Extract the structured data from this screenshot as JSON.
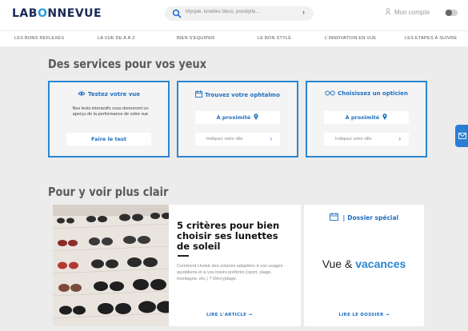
{
  "header": {
    "logo": {
      "part1": "LAB",
      "part2": "O",
      "part3": "NNEVUE"
    },
    "search_placeholder": "Myopie, lunettes bleus, presbytie...",
    "search_go": "›",
    "account_label": "Mon compte"
  },
  "nav": [
    "LES BONS REFLEXES",
    "LA VUE DE A À Z",
    "BIEN S'EQUIPER",
    "LE BON STYLE",
    "L'INNOVATION EN VUE",
    "LES ETAPES À SUIVRE"
  ],
  "services": {
    "heading": "Des services pour vos yeux",
    "cards": [
      {
        "title": "Testez votre vue",
        "icon": "eye-icon",
        "description": "Nos tests interactifs vous donneront un aperçu de la performance de votre vue",
        "button": "Faire le test"
      },
      {
        "title": "Trouvez votre ophtalmo",
        "icon": "calendar-icon",
        "button": "À proximité",
        "field_placeholder": "Indiquez votre ville"
      },
      {
        "title": "Choisissez un opticien",
        "icon": "glasses-icon",
        "button": "À proximité",
        "field_placeholder": "Indiquez votre ville"
      }
    ]
  },
  "clarity": {
    "heading": "Pour y voir plus clair",
    "article": {
      "title": "5 critères pour bien choisir ses lunettes de soleil",
      "description": "Comment choisir des solaires adaptées à vos usages quotidiens et à vos loisirs préférés (sport, plage, montagne, etc.) ? Décryptage.",
      "link": "LIRE L'ARTICLE →"
    },
    "dossier": {
      "heading": "Dossier spécial",
      "title_part1": "Vue &",
      "title_part2": "vacances",
      "link": "LIRE LE DOSSIER →"
    }
  },
  "colors": {
    "accent": "#2a86d0",
    "navy": "#1a2a55"
  }
}
